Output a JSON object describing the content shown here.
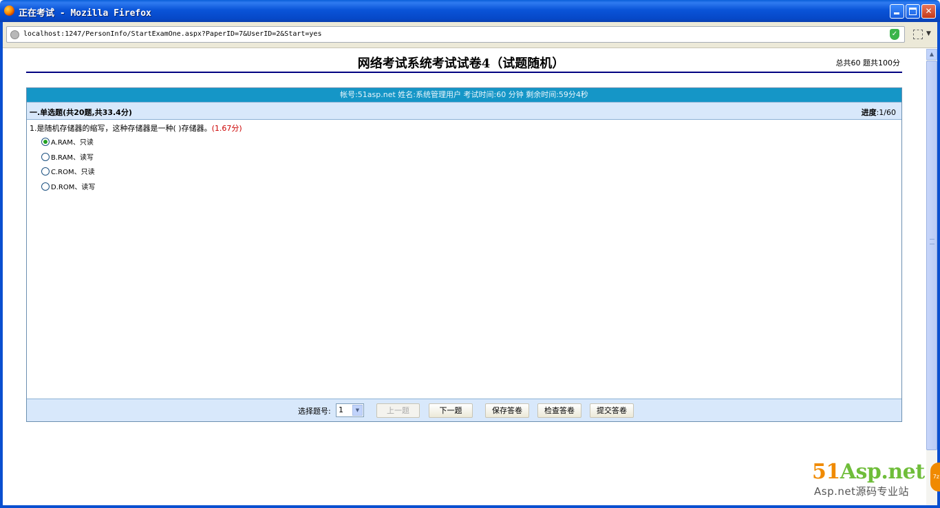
{
  "window": {
    "title": "正在考试 - Mozilla Firefox"
  },
  "browser": {
    "url": "localhost:1247/PersonInfo/StartExamOne.aspx?PaperID=7&UserID=2&Start=yes",
    "shield_icon": "shield-check-icon"
  },
  "exam": {
    "title": "网络考试系统考试试卷4（试题随机）",
    "summary": "总共60 题共100分",
    "info": "帐号:51asp.net   姓名:系统管理用户   考试时间:60 分钟   剩余时间:59分4秒",
    "section_title": "一.单选题(共20题,共33.4分)",
    "progress_label": "进度",
    "progress_value": ":1/60"
  },
  "question": {
    "text": "1.是随机存储器的缩写，这种存储器是一种(   )存储器。",
    "score": "(1.67分)",
    "options": [
      {
        "label": "A.RAM、只读",
        "checked": true
      },
      {
        "label": "B.RAM、读写",
        "checked": false
      },
      {
        "label": "C.ROM、只读",
        "checked": false
      },
      {
        "label": "D.ROM、读写",
        "checked": false
      }
    ]
  },
  "nav": {
    "select_label": "选择题号:",
    "select_value": "1",
    "prev_label": "上一题",
    "next_label": "下一题",
    "save_label": "保存答卷",
    "check_label": "检查答卷",
    "submit_label": "提交答卷"
  },
  "watermark": {
    "brand_num": "51",
    "brand_rest": "Asp.net",
    "subtitle": "Asp.net源码专业站",
    "badge": "7z",
    "colors": {
      "green": "#6fbd3a",
      "orange": "#f08a00"
    }
  },
  "colors": {
    "info_bar": "#1596c7",
    "section_bar": "#d8e8fb",
    "title_rule": "#000080",
    "score_text": "#cc0000"
  }
}
